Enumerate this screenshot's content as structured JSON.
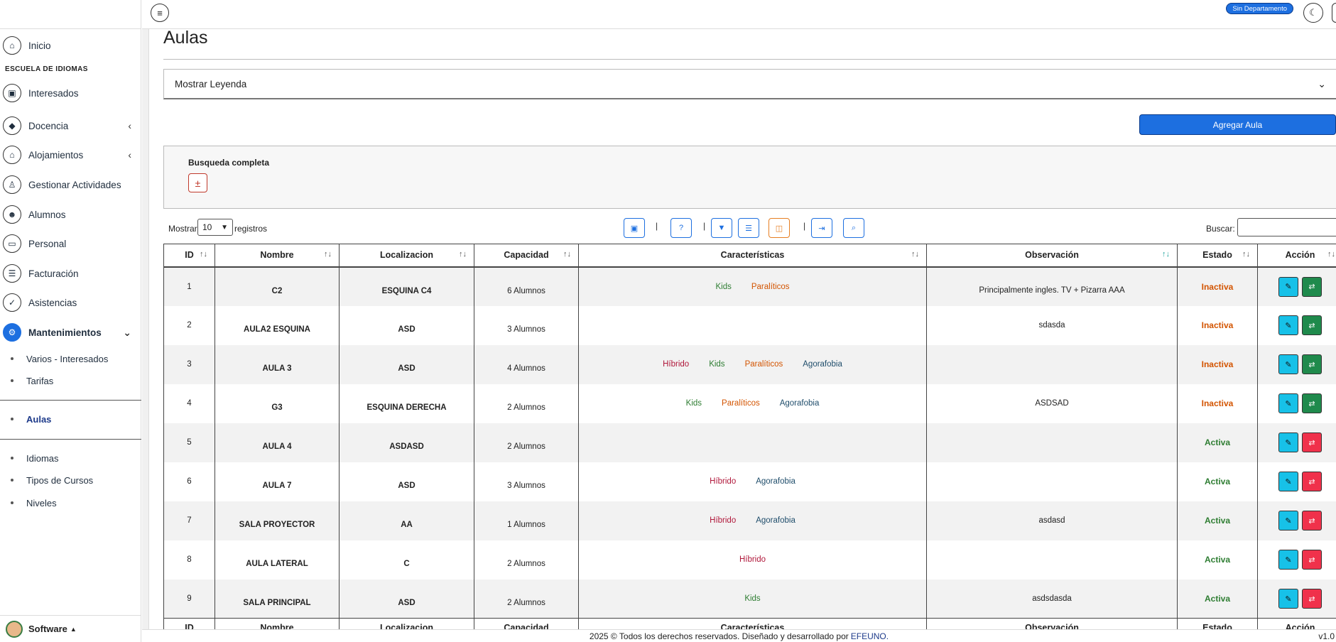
{
  "sidebar": {
    "inicio": "Inicio",
    "section": "ESCUELA DE IDIOMAS",
    "items": [
      {
        "label": "Interesados",
        "icon": "user-card-icon"
      },
      {
        "label": "Docencia",
        "icon": "graduation-cap-icon"
      },
      {
        "label": "Alojamientos",
        "icon": "house-icon"
      },
      {
        "label": "Gestionar Actividades",
        "icon": "hiker-icon"
      },
      {
        "label": "Alumnos",
        "icon": "users-icon"
      },
      {
        "label": "Personal",
        "icon": "briefcase-icon"
      },
      {
        "label": "Facturación",
        "icon": "invoice-icon"
      },
      {
        "label": "Asistencias",
        "icon": "attendance-icon"
      },
      {
        "label": "Mantenimientos",
        "icon": "gear-icon"
      }
    ],
    "sub_items": [
      "Varios - Interesados",
      "Tarifas",
      "Aulas",
      "Idiomas",
      "Tipos de Cursos",
      "Niveles"
    ],
    "footer": "Software"
  },
  "topbar": {
    "department": "Sin Departamento"
  },
  "page": {
    "title": "Aulas",
    "legend": "Mostrar Leyenda",
    "add_button": "Agregar Aula",
    "search_label": "Busqueda completa",
    "show_label": "Mostrar",
    "show_value": "10",
    "records_label": "registros",
    "buscar_label": "Buscar:"
  },
  "table": {
    "headers": [
      "ID",
      "Nombre",
      "Localizacion",
      "Capacidad",
      "Características",
      "Observación",
      "Estado",
      "Acción"
    ],
    "rows": [
      {
        "id": "1",
        "nombre": "C2",
        "loc": "ESQUINA C4",
        "cap": "6 Alumnos",
        "tags": [
          "Kids",
          "Paralíticos"
        ],
        "obs": "Principalmente ingles. TV + Pizarra AAA",
        "estado": "Inactiva"
      },
      {
        "id": "2",
        "nombre": "AULA2 ESQUINA",
        "loc": "ASD",
        "cap": "3 Alumnos",
        "tags": [],
        "obs": "sdasda",
        "estado": "Inactiva"
      },
      {
        "id": "3",
        "nombre": "AULA 3",
        "loc": "ASD",
        "cap": "4 Alumnos",
        "tags": [
          "Híbrido",
          "Kids",
          "Paralíticos",
          "Agorafobia"
        ],
        "obs": "",
        "estado": "Inactiva"
      },
      {
        "id": "4",
        "nombre": "G3",
        "loc": "ESQUINA DERECHA",
        "cap": "2 Alumnos",
        "tags": [
          "Kids",
          "Paralíticos",
          "Agorafobia"
        ],
        "obs": "ASDSAD",
        "estado": "Inactiva"
      },
      {
        "id": "5",
        "nombre": "AULA 4",
        "loc": "ASDASD",
        "cap": "2 Alumnos",
        "tags": [],
        "obs": "",
        "estado": "Activa"
      },
      {
        "id": "6",
        "nombre": "AULA 7",
        "loc": "ASD",
        "cap": "3 Alumnos",
        "tags": [
          "Híbrido",
          "Agorafobia"
        ],
        "obs": "",
        "estado": "Activa"
      },
      {
        "id": "7",
        "nombre": "SALA PROYECTOR",
        "loc": "AA",
        "cap": "1 Alumnos",
        "tags": [
          "Híbrido",
          "Agorafobia"
        ],
        "obs": "asdasd",
        "estado": "Activa"
      },
      {
        "id": "8",
        "nombre": "AULA LATERAL",
        "loc": "C",
        "cap": "2 Alumnos",
        "tags": [
          "Híbrido"
        ],
        "obs": "",
        "estado": "Activa"
      },
      {
        "id": "9",
        "nombre": "SALA PRINCIPAL",
        "loc": "ASD",
        "cap": "2 Alumnos",
        "tags": [
          "Kids"
        ],
        "obs": "asdsdasda",
        "estado": "Activa"
      }
    ]
  },
  "footer": {
    "text": "2025 © Todos los derechos reservados. Diseñado y desarrollado por",
    "link": "EFEUNO.",
    "version": "v1.0"
  },
  "colors": {
    "primary": "#1d6fe0",
    "active": "#2e7d32",
    "inactive": "#d35400",
    "edit": "#17c1e8",
    "toggle_on": "#1f8a4c",
    "toggle_off": "#f0314b"
  }
}
